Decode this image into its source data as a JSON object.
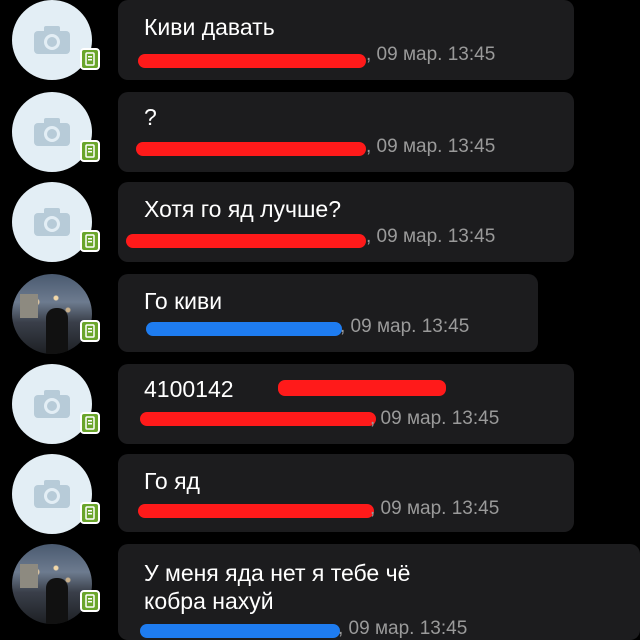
{
  "messages": [
    {
      "text": "Киви давать",
      "meta": ", 09 мар. 13:45",
      "avatar": "camera-placeholder",
      "redact_color": "#ff1a1a"
    },
    {
      "text": "?",
      "meta": ", 09 мар. 13:45",
      "avatar": "camera-placeholder",
      "redact_color": "#ff1a1a"
    },
    {
      "text": "Хотя го яд лучше?",
      "meta": ", 09 мар. 13:45",
      "avatar": "camera-placeholder",
      "redact_color": "#ff1a1a"
    },
    {
      "text": "Го киви",
      "meta": ", 09 мар. 13:45",
      "avatar": "photo",
      "redact_color": "#1e7cf0"
    },
    {
      "text": "4100142",
      "meta": ", 09 мар. 13:45",
      "avatar": "camera-placeholder",
      "redact_color": "#ff1a1a"
    },
    {
      "text": "Го яд",
      "meta": ", 09 мар. 13:45",
      "avatar": "camera-placeholder",
      "redact_color": "#ff1a1a"
    },
    {
      "text_line1": "У меня яда нет я тебе чё",
      "text_line2": "кобра нахуй",
      "meta": ", 09 мар. 13:45",
      "avatar": "photo",
      "redact_color": "#1e7cf0"
    }
  ],
  "colors": {
    "background": "#000000",
    "bubble": "#1c1c1e",
    "avatar_placeholder": "#e3eef5",
    "camera_icon": "#b7cbd8",
    "mobile_badge": "#6aa52a"
  },
  "icons": [
    "camera-icon",
    "mobile-phone-icon"
  ]
}
